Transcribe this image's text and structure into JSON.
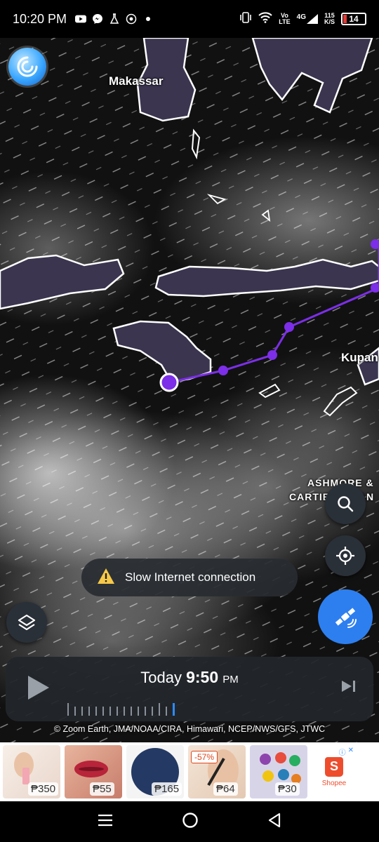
{
  "status_bar": {
    "time": "10:20 PM",
    "app_icons": [
      "youtube-icon",
      "messenger-icon",
      "flask-icon",
      "circle-app-icon"
    ],
    "network_label_top": "Vo",
    "network_label_bottom": "LTE",
    "network_type": "4G",
    "speed_top": "115",
    "speed_bottom": "K/S",
    "battery": "14"
  },
  "map": {
    "places": [
      "Makassar",
      "Kupan",
      "ASHMORE &",
      "CARTIER ISLAN"
    ],
    "track_color": "#7c2ee8",
    "land_fill": "#3b3550",
    "coast_color": "#ffffff"
  },
  "controls": {
    "search_icon": "search-icon",
    "locate_icon": "crosshair-icon",
    "layers_icon": "layers-icon",
    "satellite_icon": "satellite-icon",
    "accent": "#2d7ff0"
  },
  "toast": {
    "message": "Slow Internet connection"
  },
  "timeline": {
    "day": "Today",
    "time": "9:50",
    "ampm": "PM",
    "tick_count": 16,
    "current_tick": 16
  },
  "credits": "© Zoom Earth, JMA/NOAA/CIRA, Himawari, NCEP/NWS/GFS, JTWC",
  "ads": {
    "items": [
      {
        "price": "₱350"
      },
      {
        "price": "₱55"
      },
      {
        "price": "₱165"
      },
      {
        "price": "₱64",
        "badge": "-57%"
      },
      {
        "price": "₱30"
      }
    ],
    "brand": "Shopee"
  }
}
